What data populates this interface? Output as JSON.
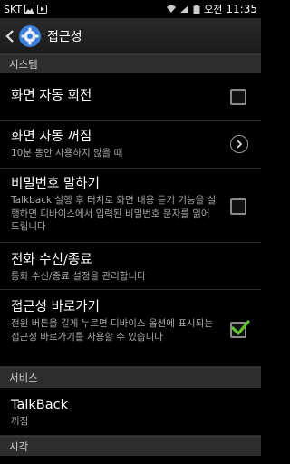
{
  "status_bar": {
    "carrier": "SKT",
    "language": "오전",
    "time": "11:35"
  },
  "action_bar": {
    "title": "접근성",
    "back_icon": "chevron-left-icon",
    "app_icon": "gear-icon"
  },
  "sections": {
    "system": "시스템",
    "service": "서비스",
    "vision": "시각"
  },
  "items": [
    {
      "title": "화면 자동 회전",
      "checked": false
    },
    {
      "title": "화면 자동 꺼짐",
      "subtitle": "10분 동안 사용하지 않을 때"
    },
    {
      "title": "비밀번호 말하기",
      "subtitle": "Talkback 실행 후 터치로 화면 내용 듣기 기능을 실행하면 디바이스에서 입력된 비밀번호 문자를 읽어 드립니다",
      "checked": false
    },
    {
      "title": "전화 수신/종료",
      "subtitle": "통화 수신/종료 설정을 관리합니다"
    },
    {
      "title": "접근성 바로가기",
      "subtitle": "전원 버튼을 길게 누르면 디바이스 옵션에 표시되는 접근성 바로가기를 사용할 수 있습니다",
      "checked": true
    },
    {
      "title": "TalkBack",
      "subtitle": "꺼짐"
    }
  ],
  "colors": {
    "check_green": "#5ec42f",
    "section_bg": "#2d2d2d"
  }
}
